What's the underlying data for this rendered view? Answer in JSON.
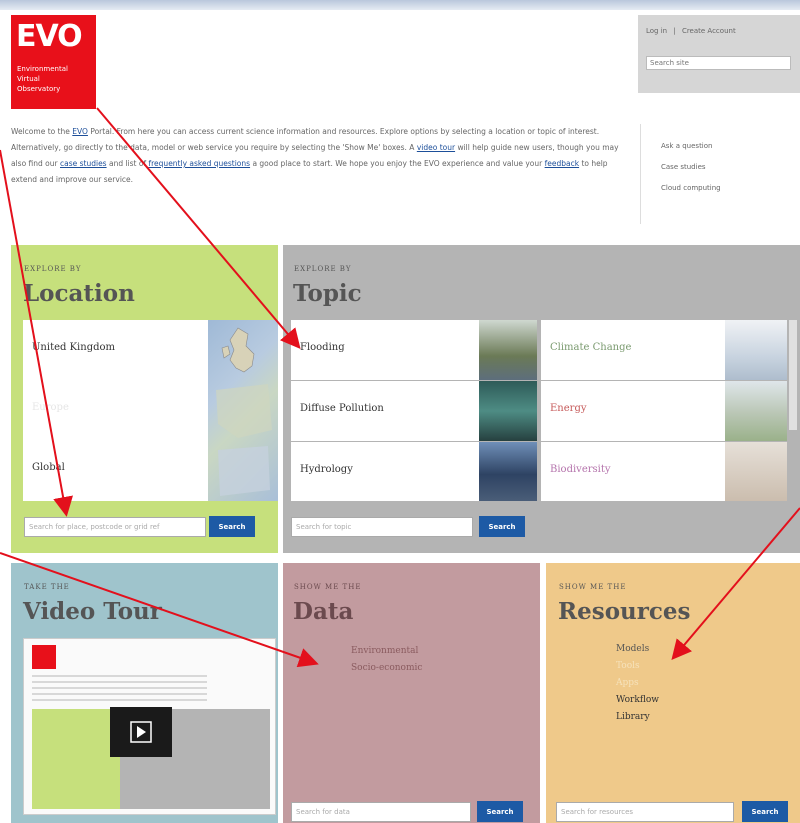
{
  "logo": {
    "title": "EVO",
    "line1": "Environmental",
    "line2": "Virtual",
    "line3": "Observatory"
  },
  "header": {
    "login": "Log in",
    "separator": "|",
    "create_account": "Create Account",
    "search_placeholder": "Search site"
  },
  "intro": {
    "t1": "Welcome to the ",
    "evo_link": "EVO",
    "t2": " Portal. From here you can access current science information and resources. Explore options by selecting a location or topic of interest. Alternatively, go directly to the data, model or web service you require by selecting the 'Show Me' boxes. A ",
    "video_link": "video tour",
    "t3": " will help guide new users, though you may also find our ",
    "case_link": "case studies",
    "t4": " and list of ",
    "faq_link": "frequently asked questions",
    "t5": " a good place to start. We hope you enjoy the EVO experience and value your ",
    "feedback_link": "feedback",
    "t6": " to help extend and improve our service."
  },
  "sidelinks": [
    "Ask a question",
    "Case studies",
    "Cloud computing"
  ],
  "location": {
    "kicker": "Explore by",
    "title": "Location",
    "items": [
      "United Kingdom",
      "Europe",
      "Global"
    ],
    "search_placeholder": "Search for place, postcode or grid ref",
    "search_button": "Search"
  },
  "topic": {
    "kicker": "Explore by",
    "title": "Topic",
    "left": [
      "Flooding",
      "Diffuse Pollution",
      "Hydrology"
    ],
    "right": [
      "Climate Change",
      "Energy",
      "Biodiversity"
    ],
    "search_placeholder": "Search for topic",
    "search_button": "Search"
  },
  "video": {
    "kicker": "Take the",
    "title": "Video Tour"
  },
  "data_panel": {
    "kicker": "Show me the",
    "title": "Data",
    "items": [
      "Environmental",
      "Socio-economic"
    ],
    "search_placeholder": "Search for data",
    "search_button": "Search"
  },
  "resources": {
    "kicker": "Show me the",
    "title": "Resources",
    "items": [
      "Models",
      "Tools",
      "Apps",
      "Workflow",
      "Library"
    ],
    "search_placeholder": "Search for resources",
    "search_button": "Search"
  },
  "colors": {
    "logo_red": "#e8101a",
    "location_green": "#c6e07c",
    "topic_grey": "#b4b4b4",
    "video_teal": "#9fc4cc",
    "data_rose": "#c29b9f",
    "resources_orange": "#efc98a",
    "search_blue": "#1d5aa5",
    "arrow_red": "#e3101c"
  }
}
